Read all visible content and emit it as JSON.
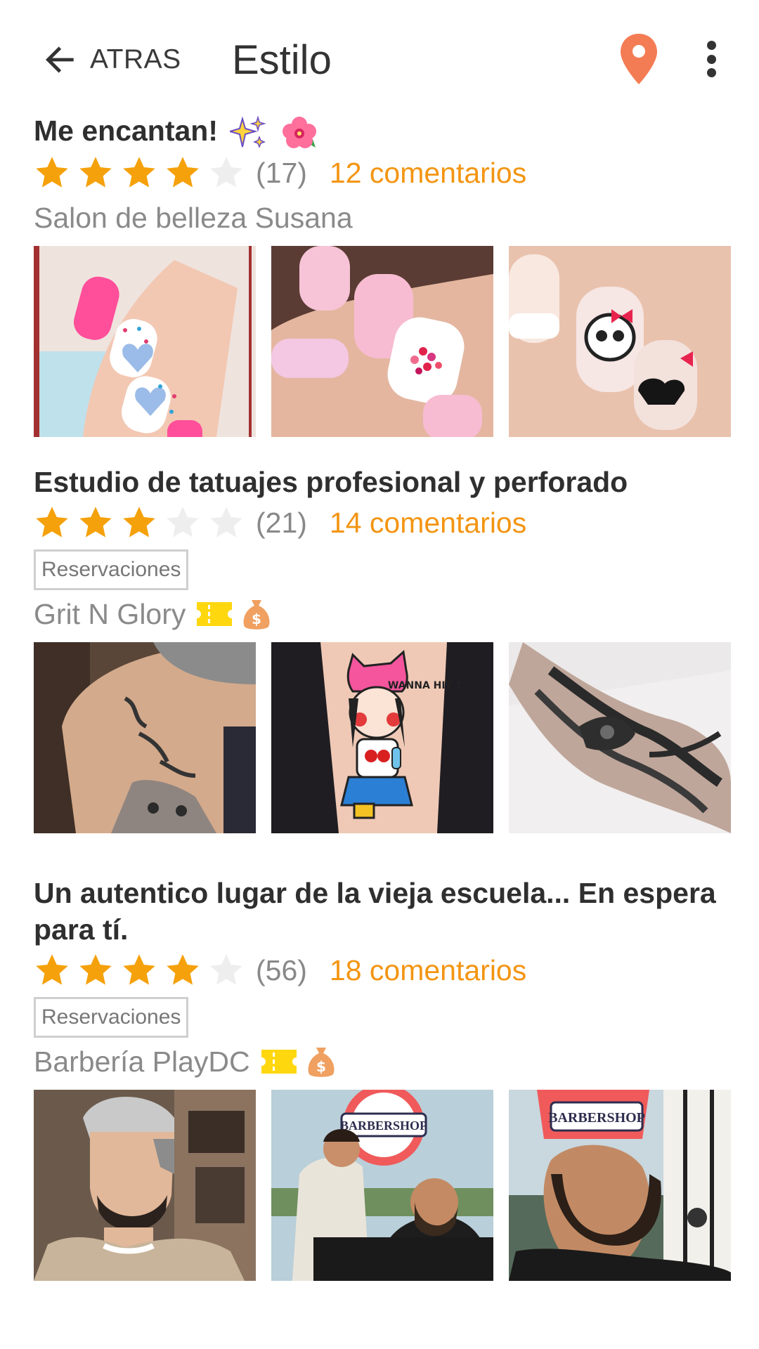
{
  "appbar": {
    "back_label": "ATRAS",
    "title": "Estilo",
    "icons": [
      "back-arrow-icon",
      "location-pin-icon",
      "more-vert-icon"
    ],
    "accent_color": "#f47c54"
  },
  "colors": {
    "star_filled": "#f5a10b",
    "star_empty": "#eeeeee",
    "comments": "#f39512"
  },
  "cards": [
    {
      "title": "Me encantan!",
      "title_emojis": [
        "sparkles-icon",
        "hibiscus-icon"
      ],
      "rating": 4,
      "rating_max": 5,
      "count": "(17)",
      "comments": "12 comentarios",
      "badge": "",
      "provider": "Salon de belleza Susana",
      "provider_icons": [],
      "thumbnails": [
        "nail-art-hearts-photo",
        "pink-nails-dots-photo",
        "nail-art-skull-photo"
      ]
    },
    {
      "title": "Estudio de tatuajes profesional y perforado",
      "rating": 3,
      "rating_max": 5,
      "count": "(21)",
      "comments": "14 comentarios",
      "badge": "Reservaciones",
      "provider": "Grit N Glory",
      "provider_icons": [
        "ticket-icon",
        "money-bag-icon"
      ],
      "thumbnails": [
        "script-tattoo-arm-photo",
        "cartoon-girl-tattoo-photo",
        "octopus-tattoo-photo"
      ],
      "tattoo_caption": "WANNA HIT ?"
    },
    {
      "title": "Un autentico lugar de la vieja escuela... En espera para tí.",
      "rating": 4,
      "rating_max": 5,
      "count": "(56)",
      "comments": "18 comentarios",
      "badge": "Reservaciones",
      "provider": "Barbería PlayDC",
      "provider_icons": [
        "ticket-icon",
        "money-bag-icon"
      ],
      "thumbnails": [
        "fade-haircut-photo",
        "beard-trim-photo",
        "barber-customer-photo"
      ],
      "shop_sign": "BARBERSHOP"
    }
  ]
}
